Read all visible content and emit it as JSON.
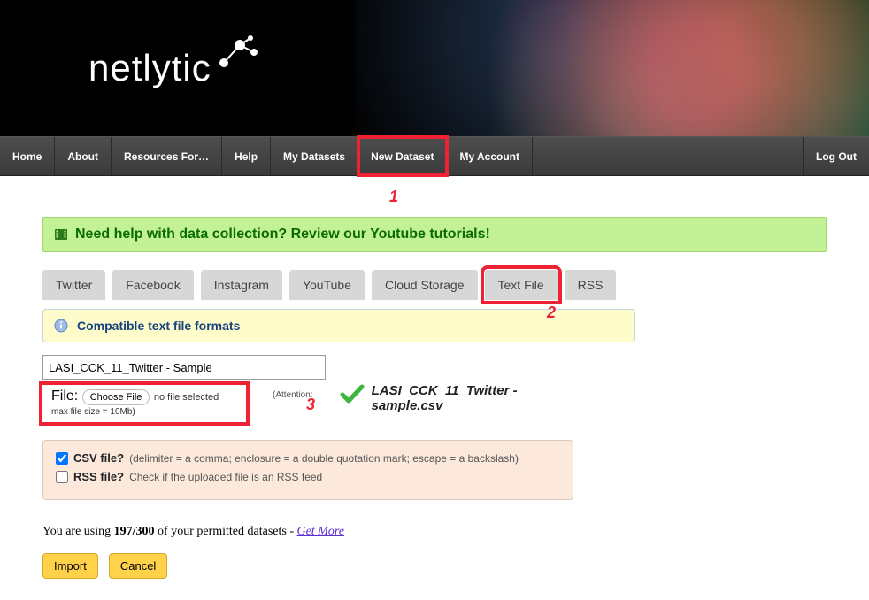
{
  "logo_text": "netlytic",
  "nav": [
    "Home",
    "About",
    "Resources For…",
    "Help",
    "My Datasets",
    "New Dataset",
    "My Account"
  ],
  "nav_logout": "Log Out",
  "help_banner": "Need help with data collection? Review our Youtube tutorials!",
  "tabs": [
    "Twitter",
    "Facebook",
    "Instagram",
    "YouTube",
    "Cloud Storage",
    "Text File",
    "RSS"
  ],
  "active_tab_index": 5,
  "info_box": "Compatible text file formats",
  "dataset_name": "LASI_CCK_11_Twitter - Sample",
  "file": {
    "label": "File:",
    "choose_btn": "Choose File",
    "no_file": "no file selected",
    "max_size": "max file size = 10Mb)",
    "attention": "(Attention:",
    "selected_name": "LASI_CCK_11_Twitter - sample.csv"
  },
  "options": {
    "csv_label": "CSV file?",
    "csv_hint": "(delimiter = a comma; enclosure = a double quotation mark; escape = a backslash)",
    "csv_checked": true,
    "rss_label": "RSS file?",
    "rss_hint": "Check if the uploaded file is an RSS feed",
    "rss_checked": false
  },
  "usage": {
    "prefix": "You are using ",
    "count": "197/300",
    "middle": " of your permitted datasets - ",
    "link": "Get More"
  },
  "buttons": {
    "import": "Import",
    "cancel": "Cancel"
  },
  "annotations": {
    "n1": "1",
    "n2": "2",
    "n3": "3"
  }
}
